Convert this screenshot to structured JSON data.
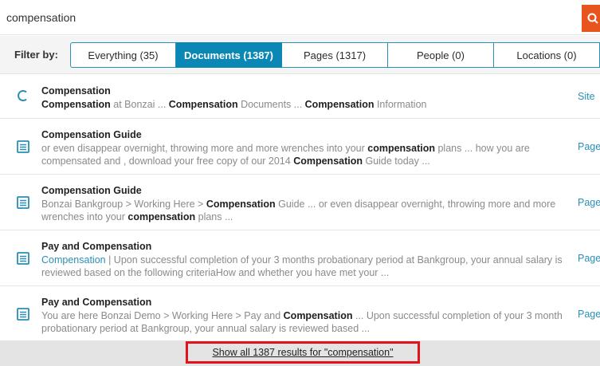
{
  "search": {
    "value": "compensation",
    "icon": "search-icon",
    "accent": "#e8541e"
  },
  "filter": {
    "label": "Filter by:",
    "tabs": [
      {
        "label": "Everything (35)",
        "active": false
      },
      {
        "label": "Documents (1387)",
        "active": true
      },
      {
        "label": "Pages (1317)",
        "active": false
      },
      {
        "label": "People (0)",
        "active": false
      },
      {
        "label": "Locations (0)",
        "active": false
      }
    ],
    "active_color": "#0a87b5"
  },
  "results": [
    {
      "title": "Compensation",
      "icon": "site-icon",
      "type": "Site",
      "snippet": [
        {
          "t": "Compensation",
          "b": true
        },
        {
          "t": " at Bonzai ... "
        },
        {
          "t": "Compensation",
          "b": true
        },
        {
          "t": " Documents ... "
        },
        {
          "t": "Compensation",
          "b": true
        },
        {
          "t": " Information"
        }
      ]
    },
    {
      "title": "Compensation Guide",
      "icon": "page-icon",
      "type": "Page",
      "snippet": [
        {
          "t": "or even disappear overnight, throwing more and more wrenches into your "
        },
        {
          "t": "compensation",
          "b": true
        },
        {
          "t": " plans ... how you are compensated and , download your free copy of our 2014 "
        },
        {
          "t": "Compensation",
          "b": true
        },
        {
          "t": " Guide today ..."
        }
      ]
    },
    {
      "title": "Compensation Guide",
      "icon": "page-icon",
      "type": "Page",
      "snippet": [
        {
          "t": "Bonzai Bankgroup > Working Here > "
        },
        {
          "t": "Compensation",
          "b": true
        },
        {
          "t": " Guide ... or even disappear overnight, throwing more and more wrenches into your "
        },
        {
          "t": "compensation",
          "b": true
        },
        {
          "t": " plans ..."
        }
      ]
    },
    {
      "title": "Pay and Compensation",
      "icon": "page-icon",
      "type": "Page",
      "snippet": [
        {
          "t": "Compensation",
          "link": true
        },
        {
          "t": "  |  Upon successful completion of your 3 months probationary period at Bankgroup, your annual salary is reviewed based on the following criteriaHow and whether you have met your ..."
        }
      ]
    },
    {
      "title": "Pay and Compensation",
      "icon": "page-icon",
      "type": "Page",
      "snippet": [
        {
          "t": "You are here Bonzai Demo > Working Here > Pay and "
        },
        {
          "t": "Compensation",
          "b": true
        },
        {
          "t": " ... Upon successful completion of your 3 month probationary period at Bankgroup, your annual salary is reviewed based ..."
        }
      ]
    }
  ],
  "footer": {
    "show_all_label": "Show all 1387 results for \"compensation\"",
    "highlight_color": "#e3131b"
  }
}
